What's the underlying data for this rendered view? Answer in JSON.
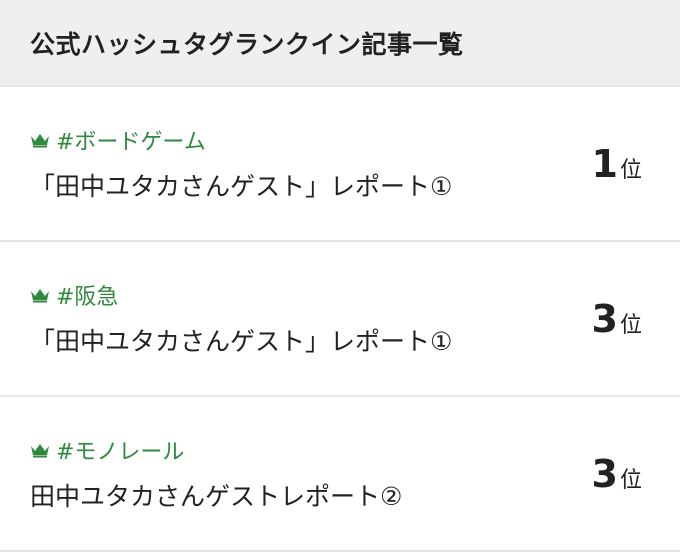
{
  "header": {
    "title": "公式ハッシュタグランクイン記事一覧"
  },
  "icons": {
    "crown": "crown-icon",
    "crown_color": "#2f8a3e"
  },
  "items": [
    {
      "hashtag": "#ボードゲーム",
      "title": "「田中ユタカさんゲスト」レポート①",
      "rank_number": "1",
      "rank_suffix": "位"
    },
    {
      "hashtag": "#阪急",
      "title": "「田中ユタカさんゲスト」レポート①",
      "rank_number": "3",
      "rank_suffix": "位"
    },
    {
      "hashtag": "#モノレール",
      "title": "田中ユタカさんゲストレポート②",
      "rank_number": "3",
      "rank_suffix": "位"
    }
  ]
}
